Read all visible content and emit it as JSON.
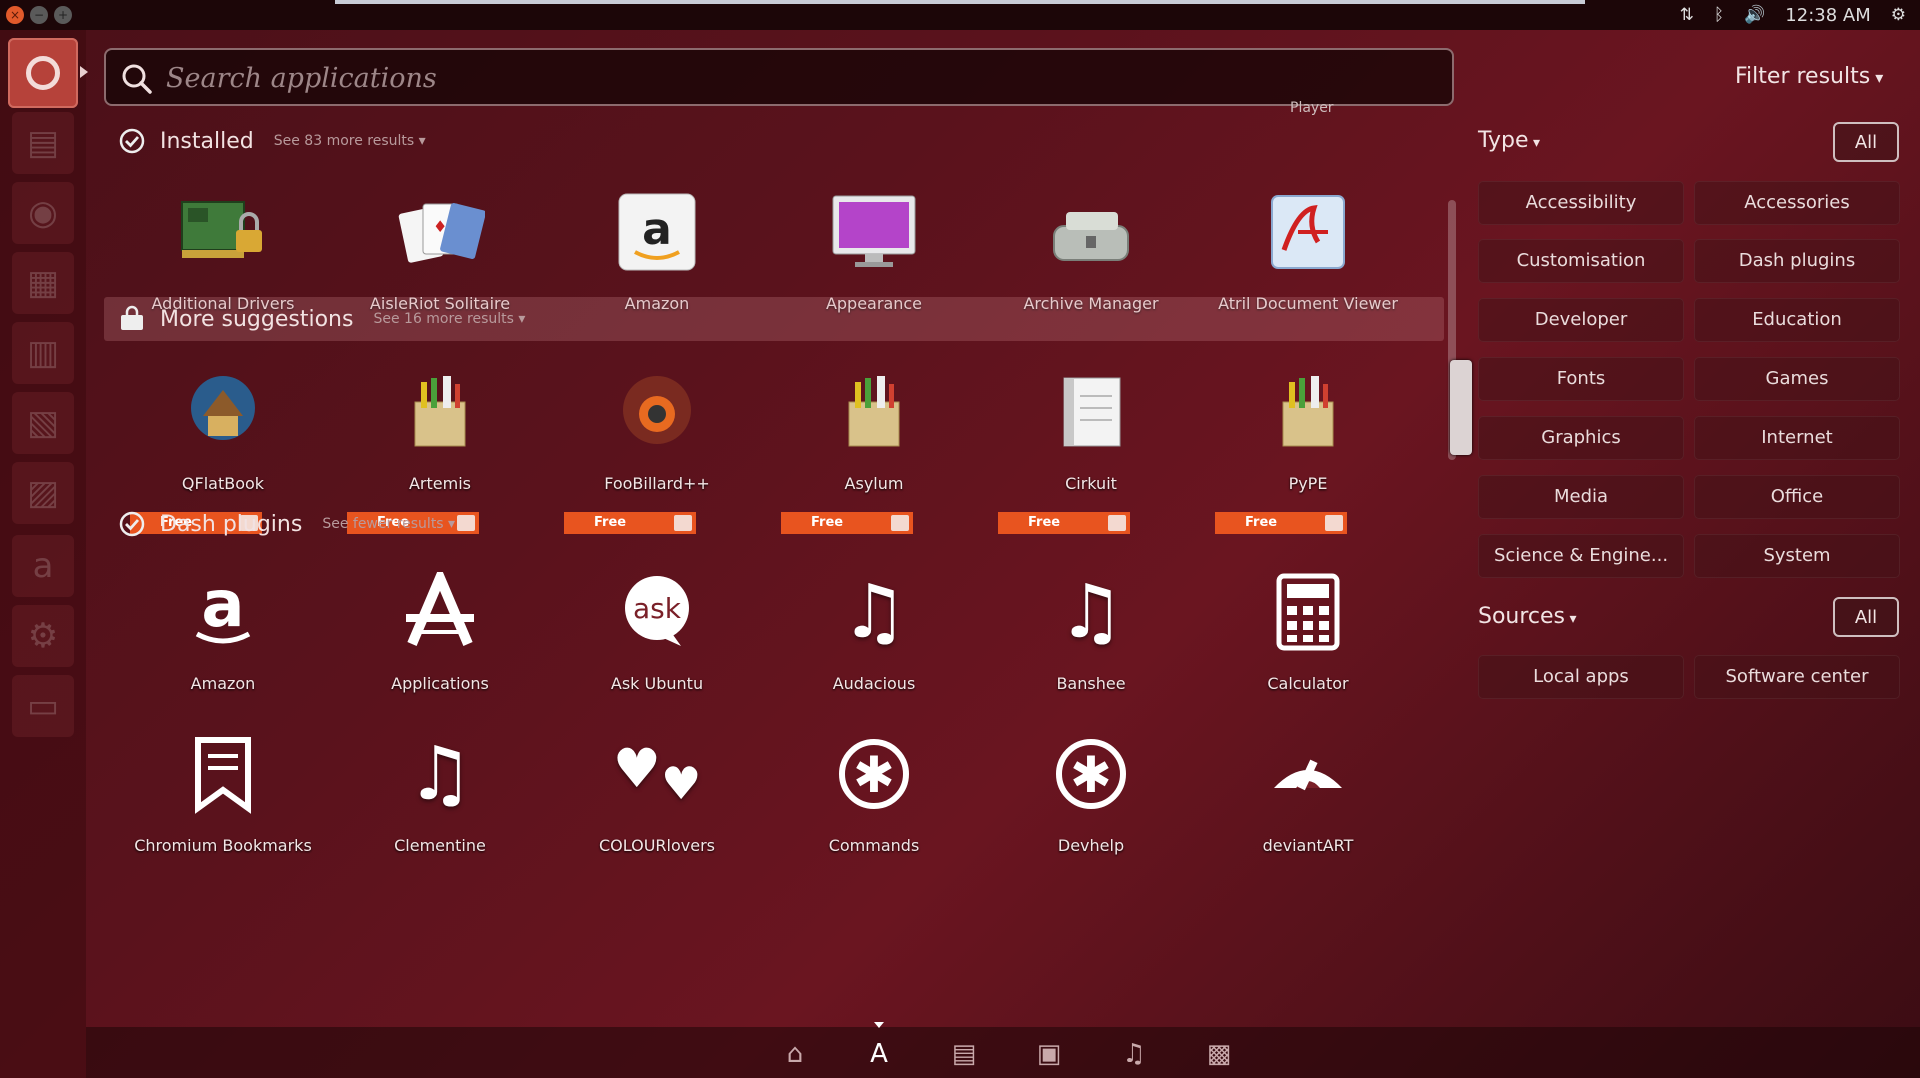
{
  "window_controls": [
    "×",
    "−",
    "+"
  ],
  "top_panel": {
    "clock": "12:38 AM"
  },
  "search": {
    "placeholder": "Search applications",
    "peek": "Player"
  },
  "categories": {
    "installed": {
      "title": "Installed",
      "more": "See 83 more results",
      "apps": [
        "Additional Drivers",
        "AisleRiot Solitaire",
        "Amazon",
        "Appearance",
        "Archive Manager",
        "Atril Document Viewer"
      ]
    },
    "suggestions": {
      "title": "More suggestions",
      "more": "See 16 more results",
      "badge": "Free",
      "apps": [
        "QFlatBook",
        "Artemis",
        "FooBillard++",
        "Asylum",
        "Cirkuit",
        "PyPE"
      ]
    },
    "dash_plugins": {
      "title": "Dash plugins",
      "more": "See fewer results",
      "apps": [
        "Amazon",
        "Applications",
        "Ask Ubuntu",
        "Audacious",
        "Banshee",
        "Calculator",
        "Chromium Bookmarks",
        "Clementine",
        "COLOURlovers",
        "Commands",
        "Devhelp",
        "deviantART"
      ]
    }
  },
  "filters": {
    "title": "Filter results",
    "type": {
      "label": "Type",
      "all": "All",
      "items": [
        "Accessibility",
        "Accessories",
        "Customisation",
        "Dash plugins",
        "Developer",
        "Education",
        "Fonts",
        "Games",
        "Graphics",
        "Internet",
        "Media",
        "Office",
        "Science & Engine...",
        "System"
      ]
    },
    "sources": {
      "label": "Sources",
      "all": "All",
      "items": [
        "Local apps",
        "Software center"
      ]
    }
  },
  "icons": {
    "launcher": [
      "files-icon",
      "firefox-icon",
      "writer-icon",
      "document-icon",
      "spreadsheet-icon",
      "presentation-icon",
      "amazon-launcher-icon",
      "settings-icon",
      "terminal-icon"
    ],
    "lenses": [
      "home-lens-icon",
      "applications-lens-icon",
      "files-lens-icon",
      "video-lens-icon",
      "music-lens-icon",
      "photos-lens-icon"
    ]
  },
  "colors": {
    "accent": "#e8541f",
    "launcher_active": "#b6423a",
    "background": "#5a121c"
  }
}
